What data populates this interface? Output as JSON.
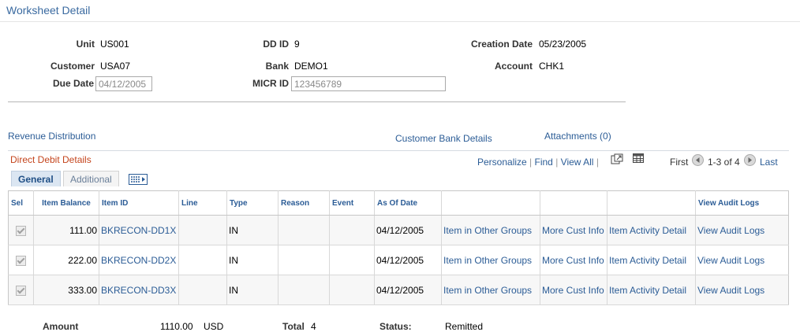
{
  "page_title": "Worksheet Detail",
  "header_fields": {
    "unit_label": "Unit",
    "unit_value": "US001",
    "ddid_label": "DD ID",
    "ddid_value": "9",
    "creation_label": "Creation Date",
    "creation_value": "05/23/2005",
    "customer_label": "Customer",
    "customer_value": "USA07",
    "bank_label": "Bank",
    "bank_value": "DEMO1",
    "account_label": "Account",
    "account_value": "CHK1",
    "due_label": "Due Date",
    "due_value": "04/12/2005",
    "micr_label": "MICR ID",
    "micr_value": "123456789"
  },
  "links": {
    "revenue": "Revenue Distribution",
    "bank_details": "Customer Bank Details",
    "attachments": "Attachments (0)"
  },
  "grid": {
    "title": "Direct Debit Details",
    "nav": {
      "personalize": "Personalize",
      "sep": "|",
      "find": "Find",
      "view_all": "View All",
      "first": "First",
      "range": "1-3 of 4",
      "last": "Last"
    },
    "tabs": {
      "general": "General",
      "additional": "Additional"
    },
    "columns": {
      "sel": "Sel",
      "item_balance": "Item Balance",
      "item_id": "Item ID",
      "line": "Line",
      "type": "Type",
      "reason": "Reason",
      "event": "Event",
      "as_of_date": "As Of Date",
      "view_audit_logs": "View Audit Logs"
    },
    "rows": [
      {
        "checked": true,
        "item_balance": "111.00",
        "item_id": "BKRECON-DD1X",
        "line": "",
        "type": "IN",
        "reason": "",
        "event": "",
        "as_of_date": "04/12/2005",
        "link_groups": "Item in Other Groups",
        "link_cust": "More Cust Info",
        "link_activity": "Item Activity Detail",
        "link_audit": "View Audit Logs"
      },
      {
        "checked": true,
        "item_balance": "222.00",
        "item_id": "BKRECON-DD2X",
        "line": "",
        "type": "IN",
        "reason": "",
        "event": "",
        "as_of_date": "04/12/2005",
        "link_groups": "Item in Other Groups",
        "link_cust": "More Cust Info",
        "link_activity": "Item Activity Detail",
        "link_audit": "View Audit Logs"
      },
      {
        "checked": true,
        "item_balance": "333.00",
        "item_id": "BKRECON-DD3X",
        "line": "",
        "type": "IN",
        "reason": "",
        "event": "",
        "as_of_date": "04/12/2005",
        "link_groups": "Item in Other Groups",
        "link_cust": "More Cust Info",
        "link_activity": "Item Activity Detail",
        "link_audit": "View Audit Logs"
      }
    ]
  },
  "footer": {
    "amount_label": "Amount",
    "amount_value": "1110.00",
    "currency": "USD",
    "total_label": "Total",
    "total_value": "4",
    "status_label": "Status:",
    "status_value": "Remitted"
  },
  "icons": {
    "download": "download-icon",
    "grid_view": "grid-icon",
    "prev": "arrow-left-icon",
    "next": "arrow-right-icon",
    "show_all_columns": "show-all-columns-icon"
  },
  "colors": {
    "link": "#2b5c96",
    "grid_title": "#c4441c",
    "page_title": "#3a6aa0"
  }
}
